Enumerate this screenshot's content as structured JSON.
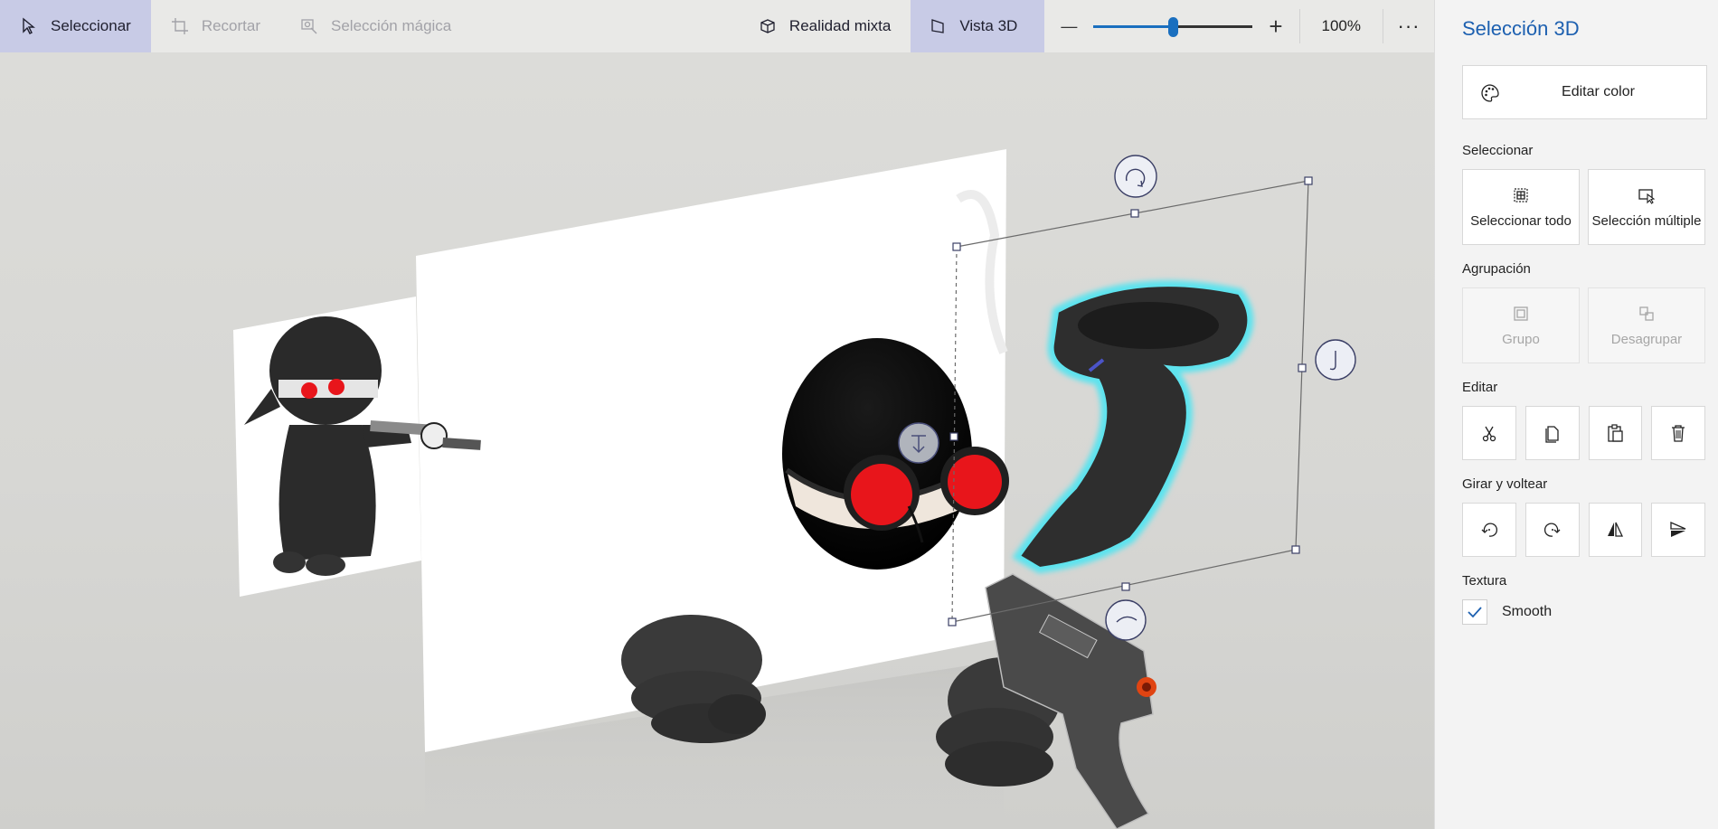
{
  "toolbar": {
    "select_label": "Seleccionar",
    "crop_label": "Recortar",
    "magic_select_label": "Selección mágica",
    "mixed_reality_label": "Realidad mixta",
    "view3d_label": "Vista 3D",
    "zoom_out_symbol": "—",
    "zoom_in_symbol": "+",
    "zoom_value": "100%",
    "zoom_slider_fraction": 0.5,
    "more_symbol": "···"
  },
  "panel": {
    "title": "Selección 3D",
    "edit_color_label": "Editar color",
    "select_section": "Seleccionar",
    "select_all_label": "Seleccionar todo",
    "multi_select_label": "Selección múltiple",
    "group_section": "Agrupación",
    "group_label": "Grupo",
    "ungroup_label": "Desagrupar",
    "edit_section": "Editar",
    "rotate_section": "Girar y voltear",
    "texture_section": "Textura",
    "smooth_label": "Smooth",
    "smooth_checked": true
  },
  "colors": {
    "accent": "#1d60b0",
    "active_tool_bg": "#c8cbe6",
    "selection_glow": "#5ee3ee",
    "goggles_red": "#e8151b"
  }
}
